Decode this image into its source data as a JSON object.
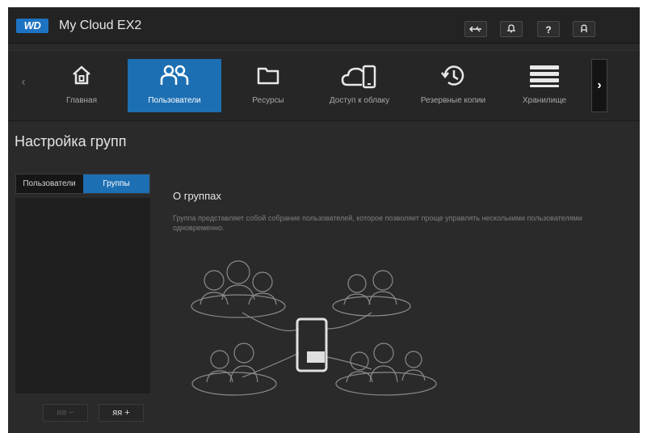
{
  "header": {
    "logo_text": "WD",
    "product_name": "My Cloud EX2"
  },
  "header_buttons": [
    {
      "name": "usb-button",
      "icon": "usb-icon",
      "glyph": "⇠"
    },
    {
      "name": "alerts-button",
      "icon": "bell-icon",
      "glyph": "♫"
    },
    {
      "name": "help-button",
      "icon": "question-icon",
      "glyph": "?"
    },
    {
      "name": "user-button",
      "icon": "user-icon",
      "glyph": "Ꭿ"
    }
  ],
  "nav": {
    "prev_glyph": "‹",
    "next_glyph": "›",
    "items": [
      {
        "label": "Главная",
        "icon": "home-icon"
      },
      {
        "label": "Пользователи",
        "icon": "users-icon",
        "active": true
      },
      {
        "label": "Ресурсы",
        "icon": "folder-icon"
      },
      {
        "label": "Доступ к облаку",
        "icon": "cloud-device-icon"
      },
      {
        "label": "Резервные копии",
        "icon": "history-icon"
      },
      {
        "label": "Хранилище",
        "icon": "storage-icon"
      }
    ]
  },
  "page": {
    "title": "Настройка групп"
  },
  "left_panel": {
    "tabs": [
      "Пользователи",
      "Группы"
    ],
    "active_tab": "Группы",
    "remove_label": "ᴙᴙ −",
    "add_label": "ᴙᴙ +"
  },
  "about": {
    "title": "О группах",
    "text": "Группа представляет собой собрание пользователей, которое позволяет проще управлять несколькими пользователями одновременно."
  },
  "colors": {
    "accent": "#1d6fb3",
    "background": "#2a2a2a",
    "header": "#232323"
  }
}
